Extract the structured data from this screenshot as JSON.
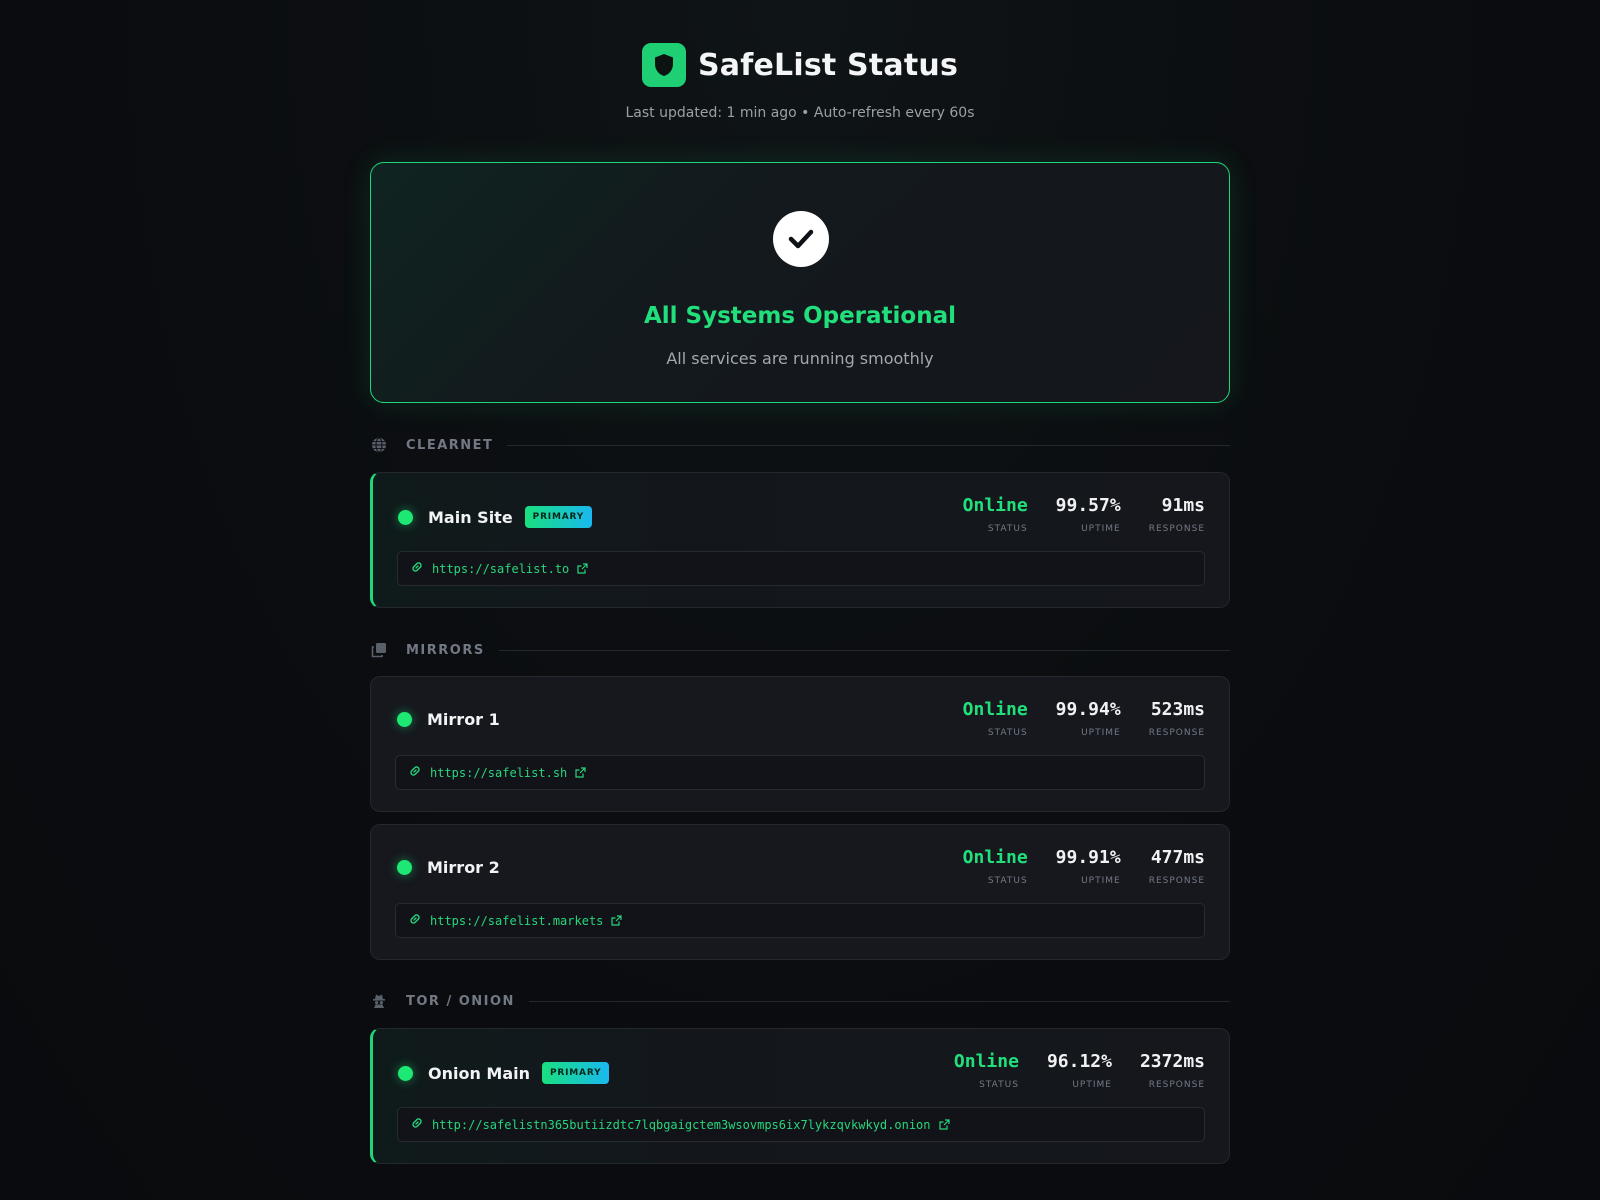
{
  "header": {
    "title": "SafeList Status",
    "subtitle": "Last updated: 1 min ago • Auto-refresh every 60s",
    "logo_icon": "shield-icon",
    "accent": "#1fcf74"
  },
  "overall": {
    "icon": "check-icon",
    "title": "All Systems Operational",
    "subtitle": "All services are running smoothly",
    "color": "#21e07c"
  },
  "sections": [
    {
      "label": "CLEARNET",
      "icon": "globe-icon",
      "services": [
        {
          "name": "Main Site",
          "badge": "PRIMARY",
          "status": "Online",
          "uptime": "99.57%",
          "response": "91ms",
          "url": "https://safelist.to"
        }
      ]
    },
    {
      "label": "MIRRORS",
      "icon": "copy-icon",
      "services": [
        {
          "name": "Mirror 1",
          "status": "Online",
          "uptime": "99.94%",
          "response": "523ms",
          "url": "https://safelist.sh"
        },
        {
          "name": "Mirror 2",
          "status": "Online",
          "uptime": "99.91%",
          "response": "477ms",
          "url": "https://safelist.markets"
        }
      ]
    },
    {
      "label": "TOR / ONION",
      "icon": "spy-icon",
      "services": [
        {
          "name": "Onion Main",
          "badge": "PRIMARY",
          "status": "Online",
          "uptime": "96.12%",
          "response": "2372ms",
          "url": "http://safelistn365butiizdtc7lqbgaigctem3wsovmps6ix7lykzqvkwkyd.onion"
        }
      ]
    }
  ],
  "labels": {
    "status": "STATUS",
    "uptime": "UPTIME",
    "response": "RESPONSE"
  },
  "status_color": "#1ee874"
}
